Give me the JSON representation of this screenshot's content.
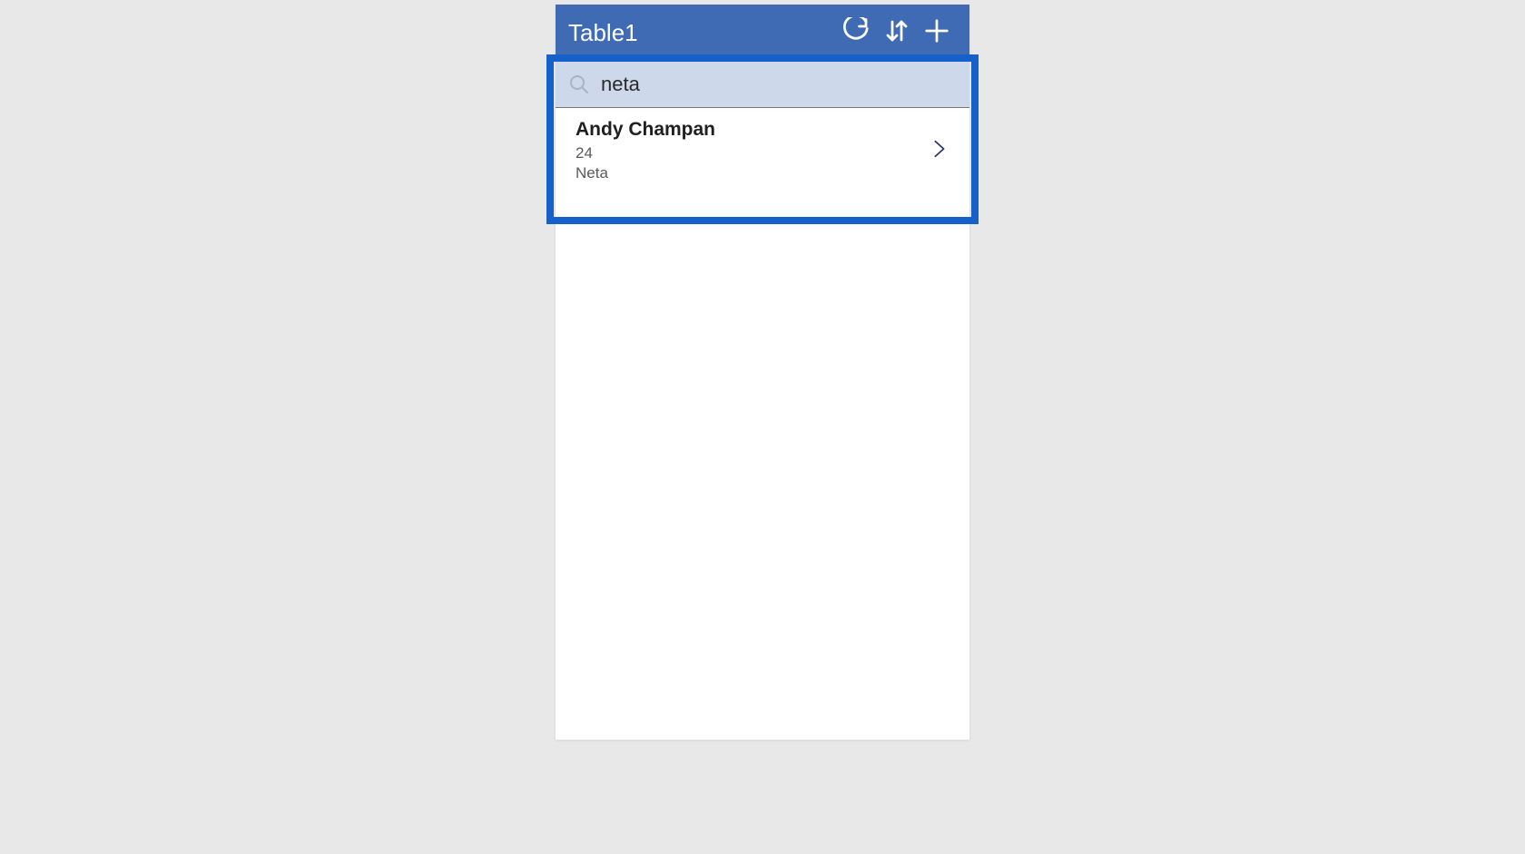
{
  "header": {
    "title": "Table1"
  },
  "search": {
    "value": "neta",
    "placeholder": ""
  },
  "results": [
    {
      "primary": "Andy Champan",
      "secondary": "24",
      "tertiary": "Neta"
    }
  ],
  "icons": {
    "refresh": "refresh-icon",
    "sort": "sort-icon",
    "add": "plus-icon",
    "search": "search-icon",
    "chevron": "chevron-right-icon"
  },
  "colors": {
    "header": "#3f6bb5",
    "highlight": "#1660c9",
    "search_bg": "#cdd8ea"
  }
}
